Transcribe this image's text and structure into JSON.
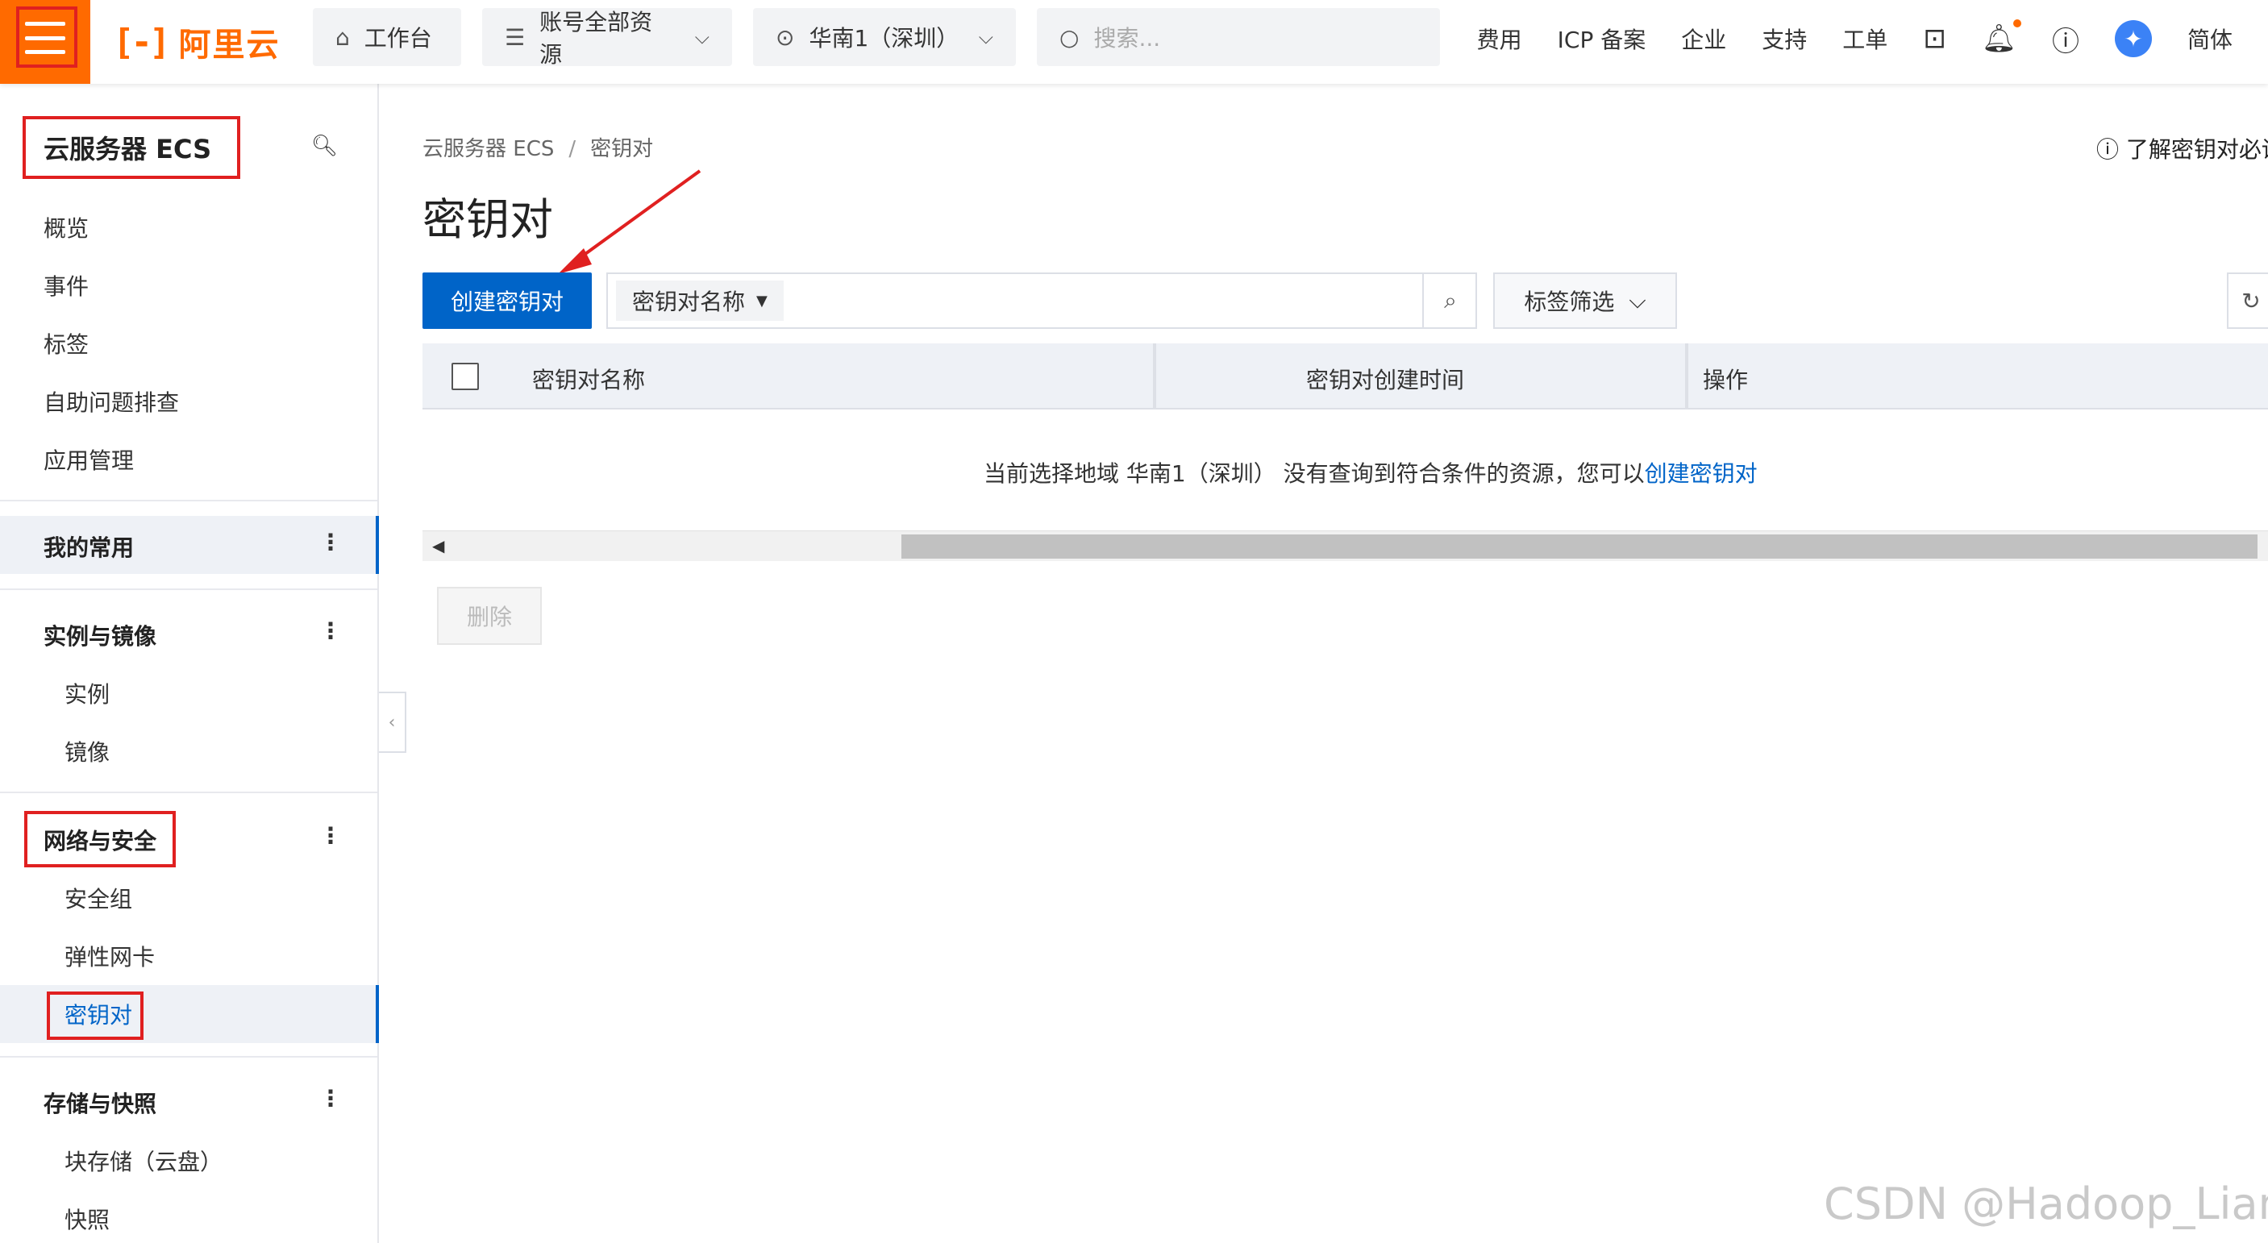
{
  "topbar": {
    "logo_text": "阿里云",
    "workbench": "工作台",
    "resources": "账号全部资源",
    "region": "华南1（深圳）",
    "search_placeholder": "搜索...",
    "links": [
      "费用",
      "ICP 备案",
      "企业",
      "支持",
      "工单"
    ],
    "lang": "简体"
  },
  "sidebar": {
    "title": "云服务器 ECS",
    "top_items": [
      "概览",
      "事件",
      "标签",
      "自助问题排查",
      "应用管理"
    ],
    "groups": {
      "favorites": "我的常用",
      "instances": {
        "label": "实例与镜像",
        "items": [
          "实例",
          "镜像"
        ]
      },
      "network": {
        "label": "网络与安全",
        "items": [
          "安全组",
          "弹性网卡",
          "密钥对"
        ]
      },
      "storage": {
        "label": "存储与快照",
        "items": [
          "块存储（云盘）",
          "快照"
        ]
      }
    }
  },
  "main": {
    "breadcrumb": [
      "云服务器 ECS",
      "/",
      "密钥对"
    ],
    "help_link": "了解密钥对必读",
    "title": "密钥对",
    "create_button": "创建密钥对",
    "search_field_select": "密钥对名称",
    "tag_filter": "标签筛选",
    "table": {
      "columns": [
        "密钥对名称",
        "密钥对创建时间",
        "操作"
      ]
    },
    "empty_text": "当前选择地域 华南1（深圳） 没有查询到符合条件的资源，您可以",
    "empty_link": "创建密钥对",
    "delete_button": "删除"
  },
  "watermark": "CSDN @Hadoop_Liang",
  "colors": {
    "brand_orange": "#ff6a00",
    "primary_blue": "#0064c8",
    "highlight_red": "#e02020"
  }
}
